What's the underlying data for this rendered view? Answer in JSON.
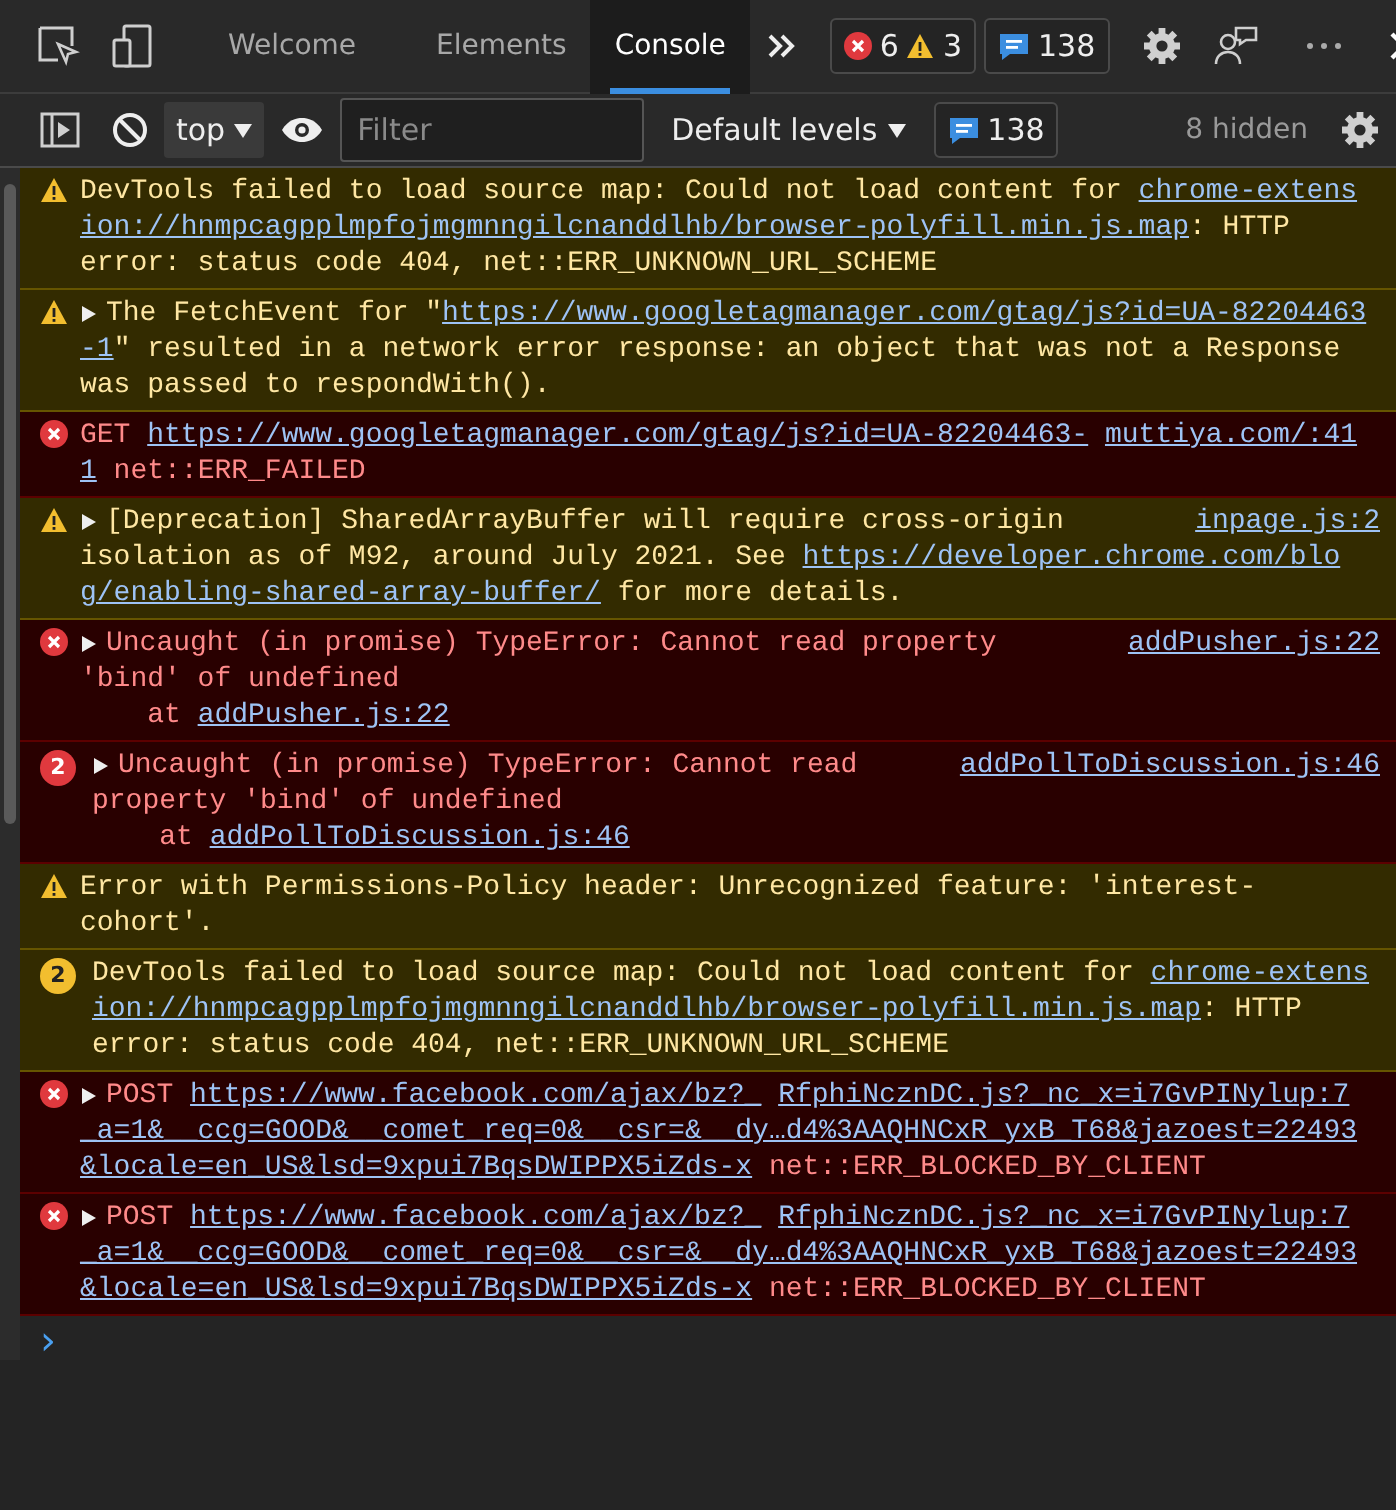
{
  "tabs": [
    {
      "label": "Welcome",
      "selected": false
    },
    {
      "label": "Elements",
      "selected": false
    },
    {
      "label": "Console",
      "selected": true
    }
  ],
  "issues": {
    "errors": "6",
    "warnings": "3"
  },
  "message_count": "138",
  "console_toolbar": {
    "context": "top",
    "filter": {
      "placeholder": "Filter"
    },
    "levels": "Default levels",
    "message_count": "138",
    "hidden": "8 hidden"
  },
  "messages": [
    {
      "kind": "warning",
      "expandable": false,
      "lines": [
        [
          {
            "text": "DevTools failed to load source map: Could not load content for ",
            "link": false
          },
          {
            "text": "chrome-extens",
            "link": true
          }
        ],
        [
          {
            "text": "ion://hnmpcagpplmpfojmgmnngilcnanddlhb/browser-polyfill.min.js.map",
            "link": true
          },
          {
            "text": ": HTTP",
            "link": false
          }
        ],
        [
          {
            "text": "error: status code 404, net::ERR_UNKNOWN_URL_SCHEME",
            "link": false
          }
        ]
      ]
    },
    {
      "kind": "warning",
      "expandable": true,
      "lines": [
        [
          {
            "text": "The FetchEvent for \"",
            "link": false
          },
          {
            "text": "https://www.googletagmanager.com/gtag/js?id=UA-82204463",
            "link": true
          }
        ],
        [
          {
            "text": "-1",
            "link": true
          },
          {
            "text": "\" resulted in a network error response: an object that was not a Response",
            "link": false
          }
        ],
        [
          {
            "text": "was passed to respondWith().",
            "link": false
          }
        ]
      ]
    },
    {
      "kind": "error",
      "expandable": false,
      "lines": [
        [
          {
            "text": "GET ",
            "link": false
          },
          {
            "text": "https://www.googletagmanager.com/gtag/js?id=UA-82204463-",
            "link": true
          },
          {
            "text": "muttiya.com/:41",
            "link": true
          }
        ],
        [
          {
            "text": "1",
            "link": true
          },
          {
            "text": " net::ERR_FAILED",
            "link": false
          }
        ]
      ]
    },
    {
      "kind": "warning",
      "expandable": true,
      "source": "inpage.js:2",
      "lines": [
        [
          {
            "text": "[Deprecation] SharedArrayBuffer will require cross-origin",
            "link": false
          }
        ],
        [
          {
            "text": "isolation as of M92, around July 2021. See ",
            "link": false
          },
          {
            "text": "https://developer.chrome.com/blo",
            "link": true
          }
        ],
        [
          {
            "text": "g/enabling-shared-array-buffer/",
            "link": true
          },
          {
            "text": " for more details.",
            "link": false
          }
        ]
      ]
    },
    {
      "kind": "error",
      "expandable": true,
      "source": "addPusher.js:22",
      "lines": [
        [
          {
            "text": "Uncaught (in promise) TypeError: Cannot read property",
            "link": false
          }
        ],
        [
          {
            "text": "'bind' of undefined",
            "link": false
          }
        ],
        [
          {
            "text": "    at ",
            "link": false
          },
          {
            "text": "addPusher.js:22",
            "link": true
          }
        ]
      ]
    },
    {
      "kind": "error",
      "expandable": true,
      "count": "2",
      "source": "addPollToDiscussion.js:46",
      "lines": [
        [
          {
            "text": "Uncaught (in promise) TypeError: Cannot read",
            "link": false
          }
        ],
        [
          {
            "text": "property 'bind' of undefined",
            "link": false
          }
        ],
        [
          {
            "text": "    at ",
            "link": false
          },
          {
            "text": "addPollToDiscussion.js:46",
            "link": true
          }
        ]
      ]
    },
    {
      "kind": "warning",
      "expandable": false,
      "lines": [
        [
          {
            "text": "Error with Permissions-Policy header: Unrecognized feature: 'interest-",
            "link": false
          }
        ],
        [
          {
            "text": "cohort'.",
            "link": false
          }
        ]
      ]
    },
    {
      "kind": "warning",
      "expandable": false,
      "count": "2",
      "lines": [
        [
          {
            "text": "DevTools failed to load source map: Could not load content for ",
            "link": false
          },
          {
            "text": "chrome-extens",
            "link": true
          }
        ],
        [
          {
            "text": "ion://hnmpcagpplmpfojmgmnngilcnanddlhb/browser-polyfill.min.js.map",
            "link": true
          },
          {
            "text": ": HTTP",
            "link": false
          }
        ],
        [
          {
            "text": "error: status code 404, net::ERR_UNKNOWN_URL_SCHEME",
            "link": false
          }
        ]
      ]
    },
    {
      "kind": "error",
      "expandable": true,
      "lines": [
        [
          {
            "text": "POST ",
            "link": false
          },
          {
            "text": "https://www.facebook.com/ajax/bz?_",
            "link": true
          },
          {
            "text": "RfphiNcznDC.js?_nc_x=i7GvPINylup:7",
            "link": true
          }
        ],
        [
          {
            "text": "_a=1&__ccg=GOOD&__comet_req=0&__csr=&__dy…d4%3AAQHNCxR_yxB_T68&jazoest=22493",
            "link": true
          }
        ],
        [
          {
            "text": "&locale=en_US&lsd=9xpui7BqsDWIPPX5iZds-x",
            "link": true
          },
          {
            "text": " net::ERR_BLOCKED_BY_CLIENT",
            "link": false
          }
        ]
      ]
    },
    {
      "kind": "error",
      "expandable": true,
      "lines": [
        [
          {
            "text": "POST ",
            "link": false
          },
          {
            "text": "https://www.facebook.com/ajax/bz?_",
            "link": true
          },
          {
            "text": "RfphiNcznDC.js?_nc_x=i7GvPINylup:7",
            "link": true
          }
        ],
        [
          {
            "text": "_a=1&__ccg=GOOD&__comet_req=0&__csr=&__dy…d4%3AAQHNCxR_yxB_T68&jazoest=22493",
            "link": true
          }
        ],
        [
          {
            "text": "&locale=en_US&lsd=9xpui7BqsDWIPPX5iZds-x",
            "link": true
          },
          {
            "text": " net::ERR_BLOCKED_BY_CLIENT",
            "link": false
          }
        ]
      ]
    }
  ],
  "prompt": "›"
}
